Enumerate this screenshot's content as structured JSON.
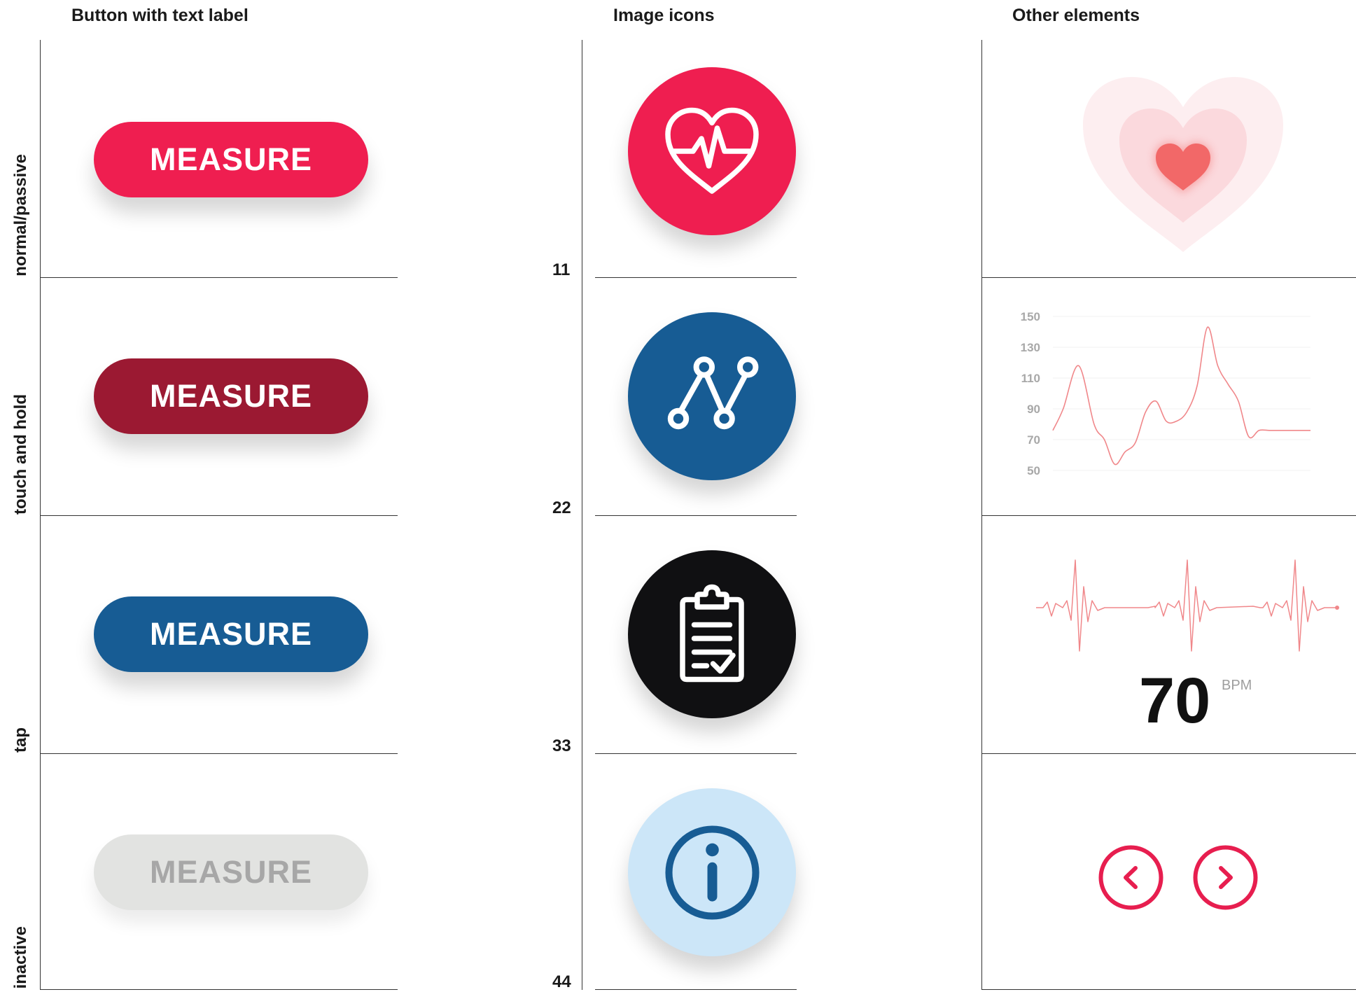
{
  "columns": {
    "buttons": "Button with text label",
    "icons": "Image icons",
    "other": "Other elements"
  },
  "rows": [
    {
      "state": "normal/passive",
      "number": "11"
    },
    {
      "state": "touch and hold",
      "number": "22"
    },
    {
      "state": "tap",
      "number": "33"
    },
    {
      "state": "inactive",
      "number": "44"
    }
  ],
  "buttons": {
    "normal": {
      "label": "MEASURE",
      "bg": "#EF1E50",
      "fg": "#ffffff"
    },
    "hold": {
      "label": "MEASURE",
      "bg": "#9B1932",
      "fg": "#ffffff"
    },
    "tap": {
      "label": "MEASURE",
      "bg": "#175C94",
      "fg": "#ffffff"
    },
    "inactive": {
      "label": "MEASURE",
      "bg": "#E2E3E1",
      "fg": "#A7A7A7"
    }
  },
  "icons": [
    {
      "name": "heart-pulse-icon",
      "bg": "#EF1E50",
      "fg": "#ffffff"
    },
    {
      "name": "line-graph-icon",
      "bg": "#175C94",
      "fg": "#ffffff"
    },
    {
      "name": "clipboard-check-icon",
      "bg": "#101012",
      "fg": "#ffffff"
    },
    {
      "name": "info-icon",
      "bg": "#CCE6F8",
      "fg": "#175C94"
    }
  ],
  "heart_colors": {
    "outer": "#FDEEF0",
    "middle": "#FBD9DD",
    "inner": "#F26868"
  },
  "chart_data": {
    "type": "line",
    "y_ticks": [
      "150",
      "130",
      "110",
      "90",
      "70",
      "50"
    ],
    "ylim": [
      50,
      150
    ],
    "grid": true,
    "color": "#F0878A",
    "series": [
      {
        "x": [
          0,
          4,
          10,
          16,
          20,
          24,
          28,
          32,
          36,
          40,
          44,
          48,
          52,
          56,
          60,
          64,
          68,
          72,
          76,
          80,
          84,
          88,
          92,
          96,
          100
        ],
        "values": [
          76,
          90,
          118,
          80,
          70,
          54,
          62,
          68,
          88,
          95,
          82,
          82,
          88,
          105,
          143,
          118,
          106,
          95,
          72,
          76,
          76,
          76,
          76,
          76,
          76
        ]
      }
    ]
  },
  "ecg_color": "#F0878A",
  "bpm": {
    "value": "70",
    "unit": "BPM"
  },
  "nav": {
    "color": "#E71E4F",
    "prev": "previous",
    "next": "next"
  }
}
